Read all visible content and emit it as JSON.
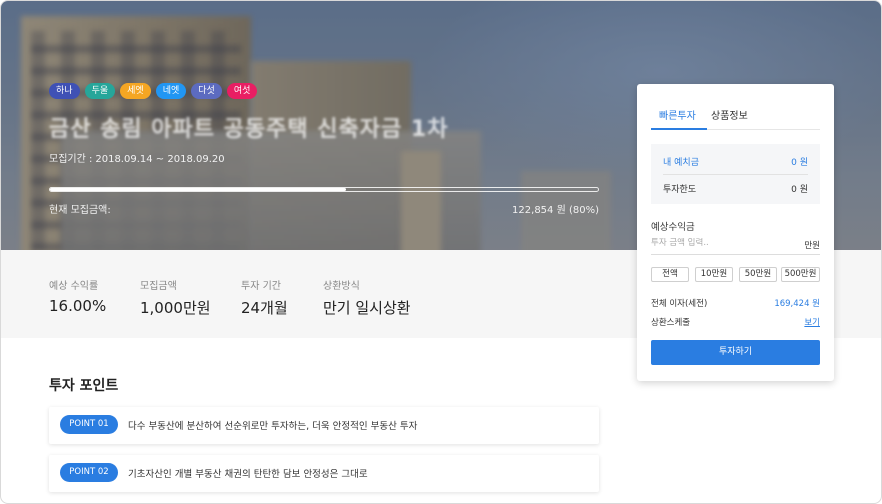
{
  "hero": {
    "badges": [
      {
        "label": "하나",
        "color": "#3f51b5"
      },
      {
        "label": "두울",
        "color": "#26a69a"
      },
      {
        "label": "세엣",
        "color": "#f5a623"
      },
      {
        "label": "네엣",
        "color": "#2196f3"
      },
      {
        "label": "다섯",
        "color": "#5c6bc0"
      },
      {
        "label": "여섯",
        "color": "#e91e63"
      }
    ],
    "title": "금산 송림 아파트 공동주택 신축자금 1차",
    "period_label": "모집기간 :",
    "period_value": "2018.09.14 ~ 2018.09.20",
    "raised_label": "현재 모집금액:",
    "raised_value": "122,854 원 (80%)",
    "progress_percent": 54
  },
  "stats": [
    {
      "label": "예상 수익률",
      "value": "16.00%"
    },
    {
      "label": "모집금액",
      "value": "1,000만원"
    },
    {
      "label": "투자 기간",
      "value": "24개월"
    },
    {
      "label": "상환방식",
      "value": "만기 일시상환"
    }
  ],
  "points": {
    "title": "투자 포인트",
    "items": [
      {
        "tag": "POINT 01",
        "text": "다수 부동산에 분산하여 선순위로만 투자하는, 더욱 안정적인 부동산 투자"
      },
      {
        "tag": "POINT 02",
        "text": "기초자산인 개별 부동산 채권의 탄탄한 담보 안정성은 그대로"
      }
    ]
  },
  "panel": {
    "tabs": [
      "빠른투자",
      "상품정보"
    ],
    "deposit_label": "내 예치금",
    "deposit_value": "0 원",
    "limit_label": "투자한도",
    "limit_value": "0 원",
    "expected_label": "예상수익금",
    "amount_placeholder": "투자 금액 입력..",
    "amount_unit": "만원",
    "quick_amounts": [
      "전액",
      "10만원",
      "50만원",
      "500만원"
    ],
    "total_interest_label": "전체 이자(세전)",
    "total_interest_value": "169,424 원",
    "schedule_label": "상환스케줄",
    "schedule_link": "보기",
    "invest_button": "투자하기",
    "accent": "#2a7de1"
  }
}
